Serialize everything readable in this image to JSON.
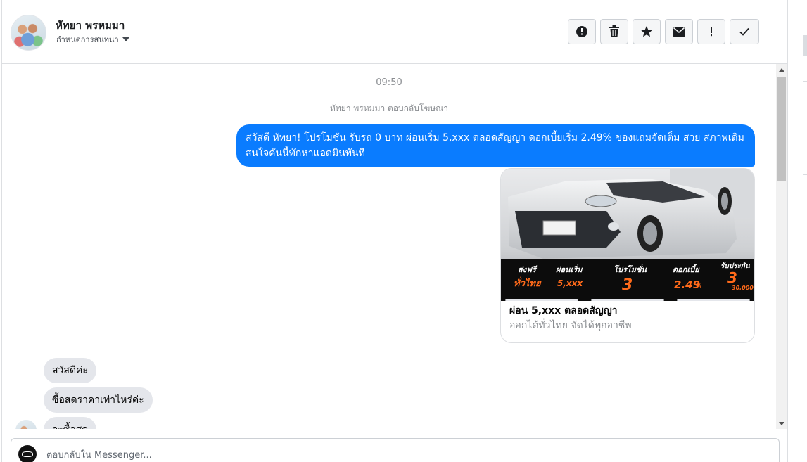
{
  "header": {
    "contact_name": "หัทยา พรหมมา",
    "assign_label": "กำหนดการสนทนา",
    "toolbar": [
      {
        "name": "report-button",
        "icon": "alert-circle-icon"
      },
      {
        "name": "delete-button",
        "icon": "trash-icon"
      },
      {
        "name": "star-button",
        "icon": "star-icon"
      },
      {
        "name": "mark-unread-button",
        "icon": "envelope-icon"
      },
      {
        "name": "spam-button",
        "icon": "exclamation-icon"
      },
      {
        "name": "done-button",
        "icon": "checkmark-icon"
      }
    ]
  },
  "thread": {
    "timestamp": "09:50",
    "reply_note": "หัทยา พรหมมา ตอบกลับโฆษณา",
    "outgoing_message": "สวัสดี หัทยา! โปรโมชั่น รับรถ 0 บาท ผ่อนเริ่ม 5,xxx ตลอดสัญญา ดอกเบี้ยเริ่ม 2.49% ของแถมจัดเต็ม สวย สภาพเดิม สนใจคันนี้ทักหาแอดมินทันที",
    "ad_card": {
      "title": "ผ่อน 5,xxx ตลอดสัญญา",
      "subtitle": "ออกได้ทั่วไทย จัดได้ทุกอาชีพ",
      "banner": {
        "free_ship": "ส่งฟรี",
        "nationwide": "ทั่วไทย",
        "installment_label": "ผ่อนเริ่ม",
        "installment_value": "5,xxx",
        "promo_label": "โปรโมชั่น",
        "promo_value": "3",
        "interest_label": "ดอกเบี้ย",
        "interest_value": "2.49",
        "interest_unit": "%",
        "insurance_label": "รับประกัน",
        "insurance_value": "3",
        "insurance_amount": "30,000"
      }
    },
    "incoming_messages": [
      "สวัสดีค่ะ",
      "ซื้อสดราคาเท่าไหร่ค่ะ",
      "จะซื้อสด"
    ]
  },
  "composer": {
    "placeholder": "ตอบกลับใน Messenger..."
  },
  "colors": {
    "outgoing_bubble": "#0a7cff",
    "incoming_bubble": "#e4e6eb",
    "banner_orange": "#ff6a1a"
  }
}
